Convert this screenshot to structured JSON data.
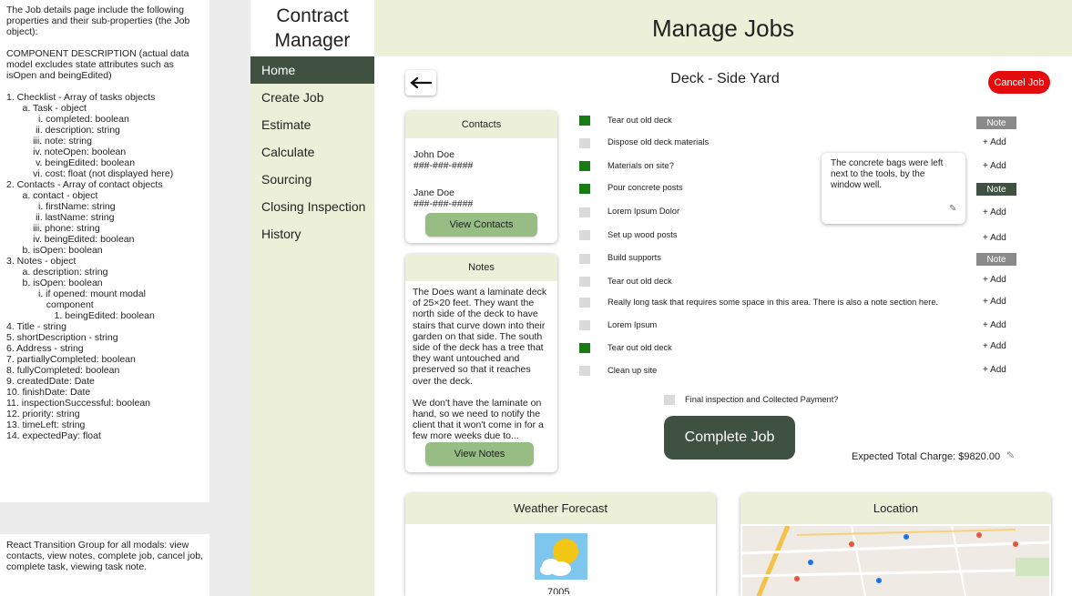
{
  "spec": {
    "intro": "The Job details page include the following properties and their sub-properties (the Job object):",
    "component_desc": "COMPONENT DESCRIPTION (actual data model excludes state attributes such as isOpen and beingEdited)",
    "lines": [
      "1. Checklist - Array of tasks objects",
      "      a. Task - object",
      "            i. completed: boolean",
      "           ii. description: string",
      "          iii. note: string",
      "          iv. noteOpen: boolean",
      "           v. beingEdited: boolean",
      "          vi. cost: float (not displayed here)",
      "2. Contacts - Array of contact objects",
      "      a. contact - object",
      "            i. firstName: string",
      "           ii. lastName: string",
      "          iii. phone: string",
      "          iv. beingEdited: boolean",
      "      b. isOpen: boolean",
      "3. Notes - object",
      "      a. description: string",
      "      b. isOpen: boolean",
      "            i. if opened: mount modal",
      "               component",
      "                  1. beingEdited: boolean",
      "4. Title - string",
      "5. shortDescription - string",
      "6. Address - string",
      "7. partiallyCompleted: boolean",
      "8. fullyCompleted: boolean",
      "9. createdDate: Date",
      "10. finishDate: Date",
      "11. inspectionSuccessful: boolean",
      "12. priority: string",
      "13. timeLeft: string",
      "14. expectedPay: float"
    ],
    "transition_note": "React Transition Group for all modals: view contacts, view notes, complete job, cancel job, complete task, viewing task note."
  },
  "brand": {
    "line1": "Contract",
    "line2": "Manager"
  },
  "nav": [
    {
      "label": "Home",
      "active": true
    },
    {
      "label": "Create Job",
      "active": false
    },
    {
      "label": "Estimate",
      "active": false
    },
    {
      "label": "Calculate",
      "active": false
    },
    {
      "label": "Sourcing",
      "active": false
    },
    {
      "label": "Closing Inspection",
      "active": false
    },
    {
      "label": "History",
      "active": false
    }
  ],
  "header": {
    "title": "Manage Jobs"
  },
  "job": {
    "title": "Deck - Side Yard",
    "cancel_label": "Cancel Job",
    "back_icon": "arrow-left-icon"
  },
  "contacts": {
    "heading": "Contacts",
    "people": [
      {
        "name": "John Doe",
        "phone": "###-###-####"
      },
      {
        "name": "Jane Doe",
        "phone": "###-###-####"
      }
    ],
    "button": "View Contacts"
  },
  "notes": {
    "heading": "Notes",
    "p1": "The Does want a laminate deck of 25×20 feet. They want the north side of the deck to have stairs that curve down into their garden on that side. The south side of the deck has a tree that they want untouched and preserved so that it reaches over the deck.",
    "p2": "We don't have the laminate on hand, so we need to notify the client that it won't come in for a few more weeks due to...",
    "button": "View Notes"
  },
  "tasks": [
    {
      "label": "Tear out old deck",
      "completed": true,
      "action": "Note"
    },
    {
      "label": "Dispose old deck materials",
      "completed": false,
      "action": "+ Add"
    },
    {
      "label": "Materials on site?",
      "completed": true,
      "action": "+ Add"
    },
    {
      "label": "Pour concrete posts",
      "completed": true,
      "action": "Note"
    },
    {
      "label": "Lorem Ipsum Dolor",
      "completed": false,
      "action": "+ Add"
    },
    {
      "label": "Set up wood posts",
      "completed": false,
      "action": "+ Add"
    },
    {
      "label": "Build supports",
      "completed": false,
      "action": "Note"
    },
    {
      "label": "Tear out old deck",
      "completed": false,
      "action": "+ Add"
    },
    {
      "label": "Really long task that requires some space in this area. There is also a note section here.",
      "completed": false,
      "action": "+ Add"
    },
    {
      "label": "Lorem Ipsum",
      "completed": false,
      "action": "+ Add"
    },
    {
      "label": "Tear out old deck",
      "completed": true,
      "action": "+ Add"
    },
    {
      "label": "Clean up site",
      "completed": false,
      "action": "+ Add"
    }
  ],
  "task_note_popup": {
    "text": "The concrete bags were left next to the tools, by the window well."
  },
  "final_inspection": {
    "label": "Final inspection and Collected Payment?",
    "completed": false
  },
  "complete_button": "Complete Job",
  "expected_charge": "Expected Total Charge: $9820.00",
  "weather": {
    "heading": "Weather Forecast",
    "icon": "partly-cloudy-icon",
    "temp_partial": "7005"
  },
  "location": {
    "heading": "Location"
  },
  "colors": {
    "accent": "#3f5140",
    "panel": "#edf0d8",
    "green_button": "#97bd85",
    "danger": "#e30b0b",
    "done_check": "#1a7a14"
  }
}
